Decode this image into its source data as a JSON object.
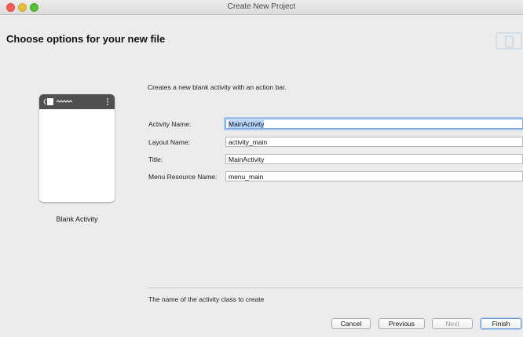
{
  "window": {
    "title": "Create New Project"
  },
  "header": {
    "title": "Choose options for your new file",
    "icon": "device-icon"
  },
  "template": {
    "caption": "Blank Activity",
    "preview_icon": "phone-preview-icon"
  },
  "form": {
    "description": "Creates a new blank activity with an action bar.",
    "fields": [
      {
        "label": "Activity Name:",
        "value": "MainActivity"
      },
      {
        "label": "Layout Name:",
        "value": "activity_main"
      },
      {
        "label": "Title:",
        "value": "MainActivity"
      },
      {
        "label": "Menu Resource Name:",
        "value": "menu_main"
      }
    ]
  },
  "hint": "The name of the activity class to create",
  "buttons": {
    "cancel": "Cancel",
    "previous": "Previous",
    "next": "Next",
    "finish": "Finish"
  },
  "colors": {
    "accent": "#7aa7e0",
    "selection": "#b4d5fe",
    "toolbar_preview": "#505050"
  }
}
